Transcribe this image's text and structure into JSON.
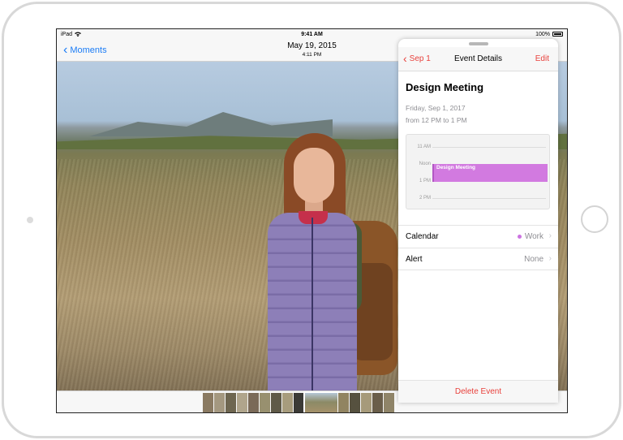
{
  "statusbar": {
    "device": "iPad",
    "time": "9:41 AM",
    "battery_pct": "100%",
    "wifi_icon": "wifi-icon",
    "battery_icon": "battery-icon"
  },
  "photos": {
    "back_label": "Moments",
    "title": "May 19, 2015",
    "subtitle": "4:11 PM"
  },
  "panel": {
    "back_label": "Sep 1",
    "title": "Event Details",
    "edit_label": "Edit",
    "event_title": "Design Meeting",
    "event_date": "Friday, Sep 1, 2017",
    "event_time": "from 12 PM to 1 PM",
    "timeline": {
      "hours": [
        "11 AM",
        "Noon",
        "1 PM",
        "2 PM"
      ],
      "event_label": "Design Meeting"
    },
    "rows": [
      {
        "label": "Calendar",
        "value": "Work"
      },
      {
        "label": "Alert",
        "value": "None"
      }
    ],
    "delete_label": "Delete Event"
  },
  "colors": {
    "photos_accent": "#1b7cf6",
    "calendar_accent": "#e8413c",
    "event_color": "#d27ae0"
  }
}
